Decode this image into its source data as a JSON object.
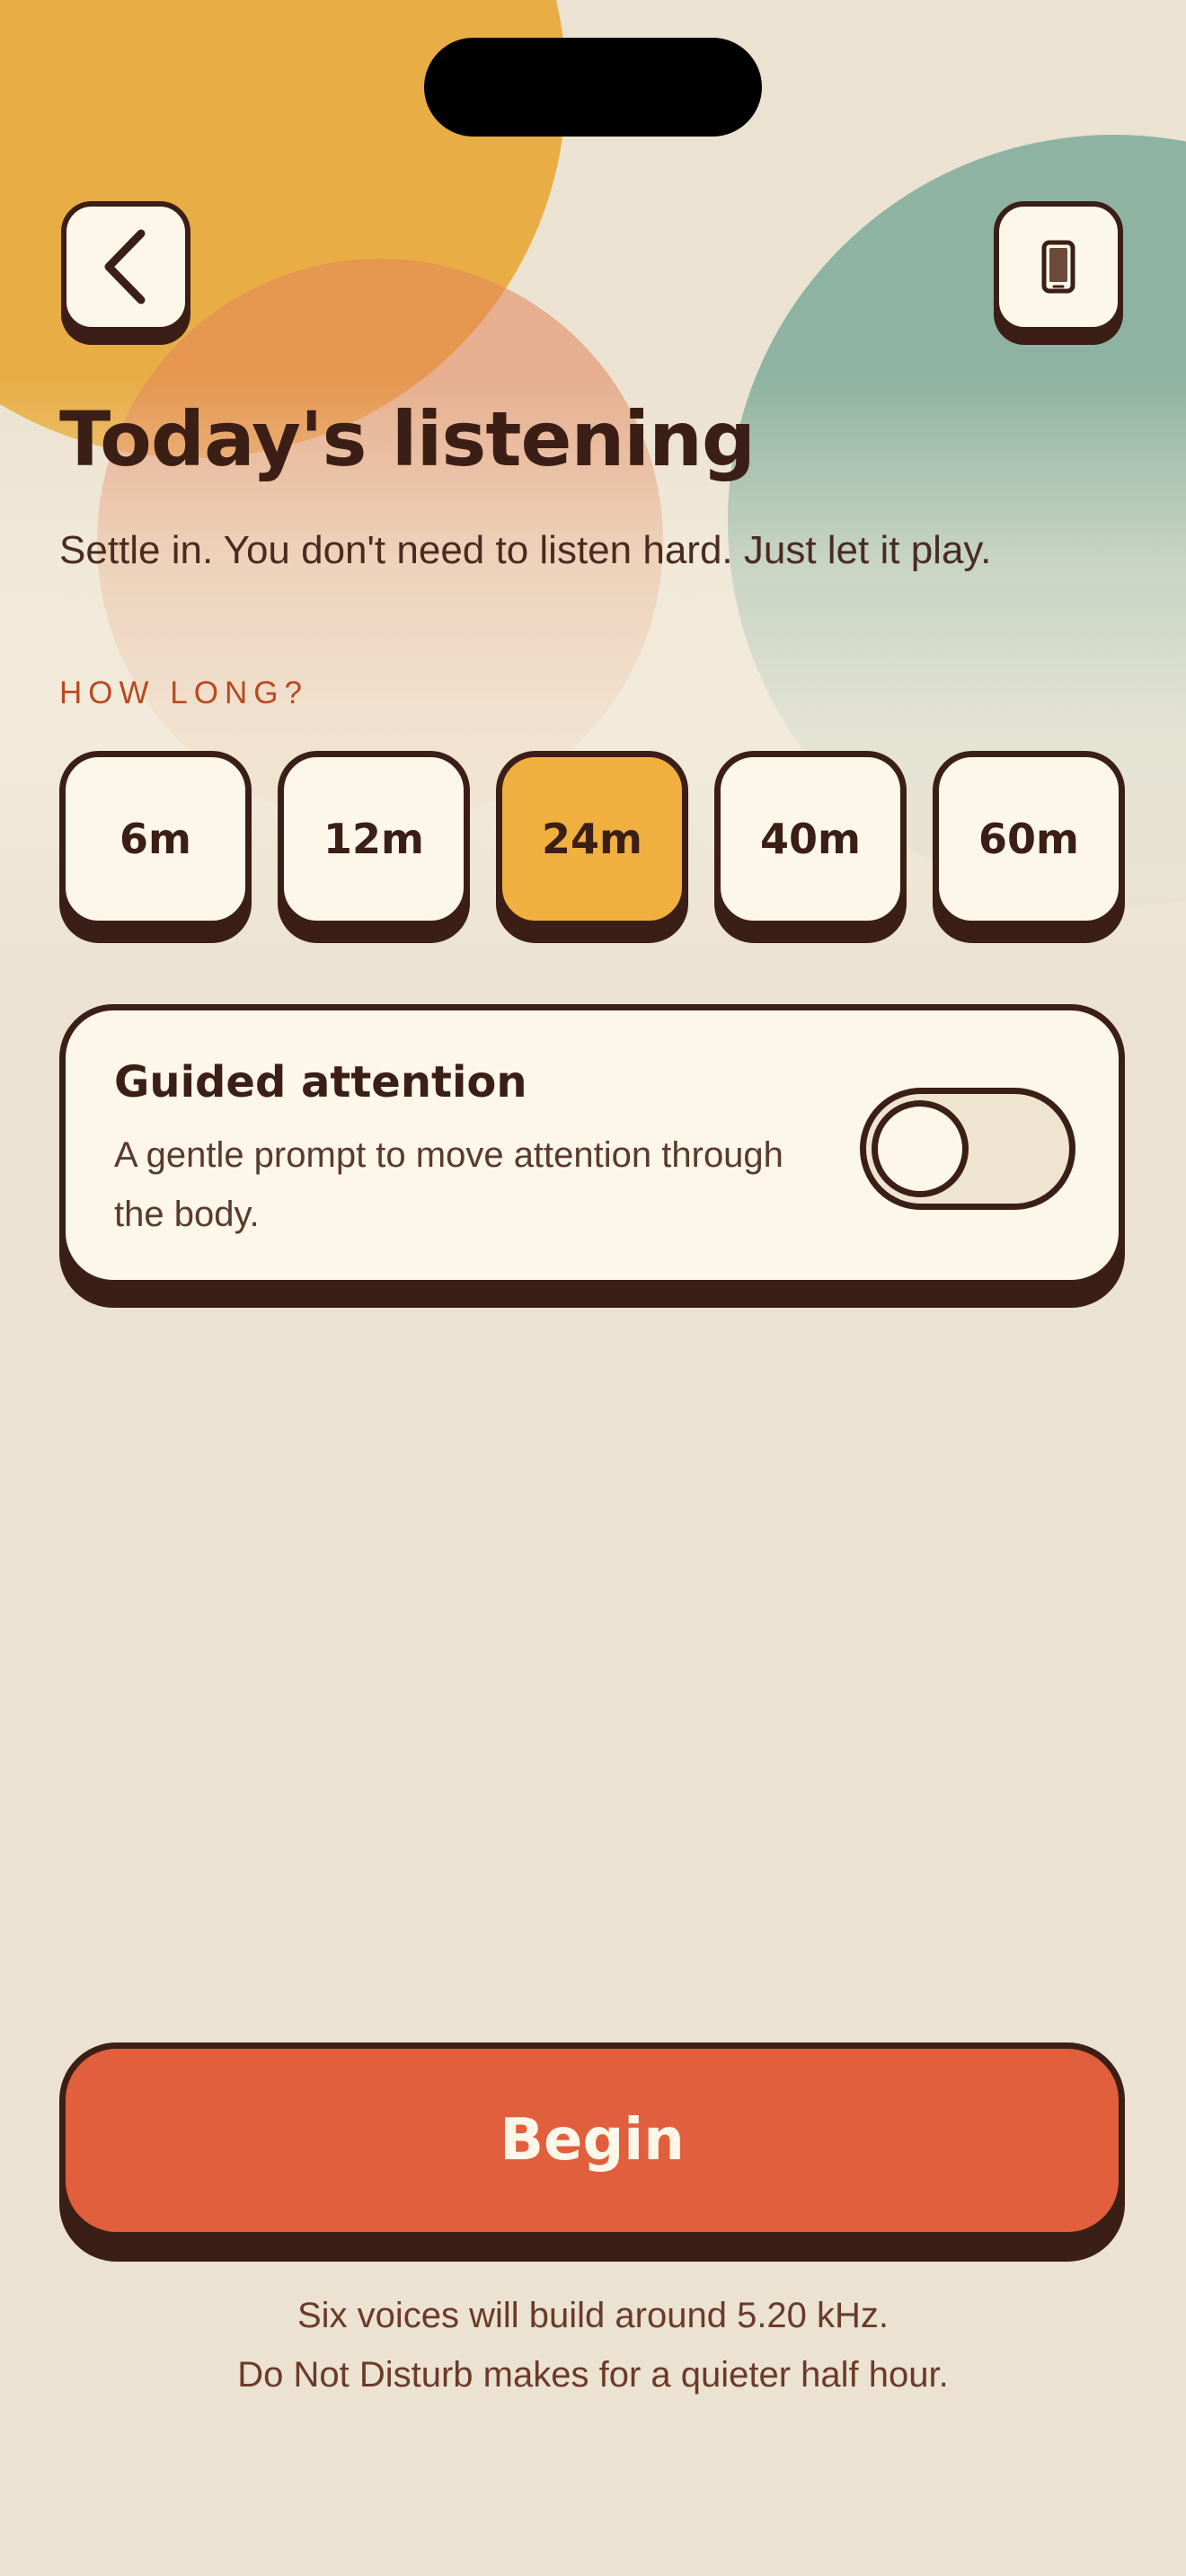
{
  "header": {
    "back_icon": "chevron-left-icon",
    "device_icon": "phone-icon"
  },
  "main": {
    "title": "Today's listening",
    "subtitle": "Settle in. You don't need to listen hard. Just let it play.",
    "duration_label": "HOW LONG?",
    "durations": [
      "6m",
      "12m",
      "24m",
      "40m",
      "60m"
    ],
    "selected_duration": "24m"
  },
  "guided": {
    "title": "Guided attention",
    "description": "A gentle prompt to move attention through the body.",
    "enabled": false
  },
  "action": {
    "begin_label": "Begin"
  },
  "footer": {
    "line1": "Six voices will build around 5.20 kHz.",
    "line2": "Do Not Disturb makes for a quieter half hour."
  },
  "colors": {
    "background": "#ebe2d1",
    "ink": "#3b1f16",
    "accent_orange": "#e8ad45",
    "accent_teal": "#8fb3a2",
    "selected_chip": "#f0b040",
    "begin_button": "#e15f3c",
    "section_label": "#b84a20"
  }
}
